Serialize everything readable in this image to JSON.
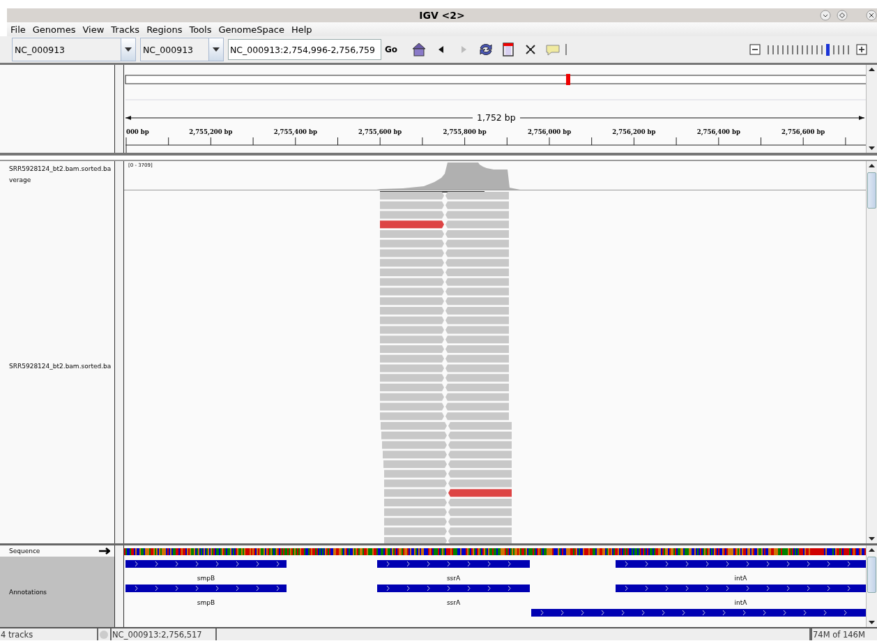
{
  "window": {
    "title": "IGV <2>"
  },
  "menu": [
    "File",
    "Genomes",
    "View",
    "Tracks",
    "Regions",
    "Tools",
    "GenomeSpace",
    "Help"
  ],
  "toolbar": {
    "genome": "NC_000913",
    "chromosome": "NC_000913",
    "locus": "NC_000913:2,754,996-2,756,759",
    "go": "Go",
    "back_disabled": false,
    "forward_disabled": true,
    "zoom": {
      "level": 0.75
    }
  },
  "ruler": {
    "span": "1,752 bp",
    "ticks": [
      "000 bp",
      "2,755,200 bp",
      "2,755,400 bp",
      "2,755,600 bp",
      "2,755,800 bp",
      "2,756,000 bp",
      "2,756,200 bp",
      "2,756,400 bp",
      "2,756,600 bp"
    ]
  },
  "tracks": [
    {
      "kind": "coverage",
      "name_lines": [
        "SRR5928124_bt2.bam.sorted.ba",
        "verage"
      ],
      "range": "[0 - 3709]"
    },
    {
      "kind": "alignment",
      "name_lines": [
        "SRR5928124_bt2.bam.sorted.ba"
      ]
    }
  ],
  "sequence": {
    "name": "Sequence"
  },
  "annotations": {
    "name": "Annotations",
    "rows": [
      {
        "features": [
          {
            "kind": "gene",
            "label": "smpB"
          },
          {
            "kind": "gene",
            "label": "ssrA"
          },
          {
            "kind": "gene",
            "label": "intA"
          }
        ]
      },
      {
        "features": [
          {
            "kind": "gene",
            "label": "smpB"
          },
          {
            "kind": "gene",
            "label": "ssrA"
          },
          {
            "kind": "gene",
            "label": "intA"
          }
        ]
      },
      {
        "features": [
          {
            "kind": "gene"
          }
        ]
      }
    ]
  },
  "status_bar": {
    "tracks": "4 tracks",
    "position": "NC_000913:2,756,517",
    "memory": "74M of 146M"
  }
}
